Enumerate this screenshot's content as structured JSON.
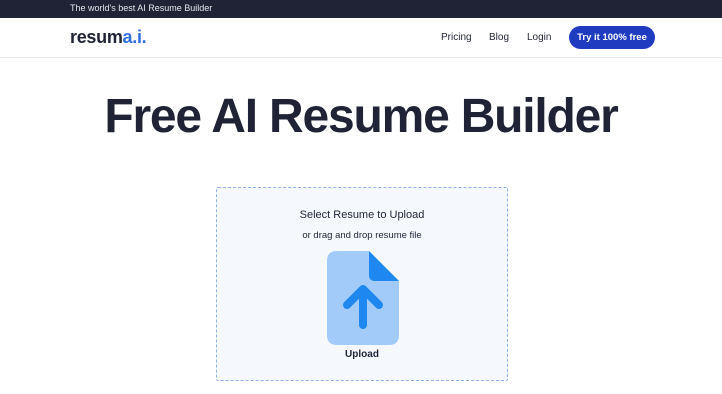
{
  "top_banner": {
    "text": "The world's best AI Resume Builder"
  },
  "nav": {
    "logo_main": "resum",
    "logo_accent": "a.i.",
    "links": [
      "Pricing",
      "Blog",
      "Login"
    ],
    "cta_label": "Try it 100% free"
  },
  "hero": {
    "title": "Free AI Resume Builder"
  },
  "upload": {
    "heading": "Select Resume to Upload",
    "subtext": "or drag and drop resume file",
    "button_label": "Upload",
    "icon": "file-upload-icon"
  },
  "colors": {
    "dark": "#1f2335",
    "brand_blue": "#1f3bbf",
    "logo_accent": "#2f6fe0",
    "icon_light": "#a3cbfa",
    "icon_dark": "#1e88f0",
    "zone_bg": "#f5f8fd",
    "zone_border": "#8fb3e6"
  }
}
